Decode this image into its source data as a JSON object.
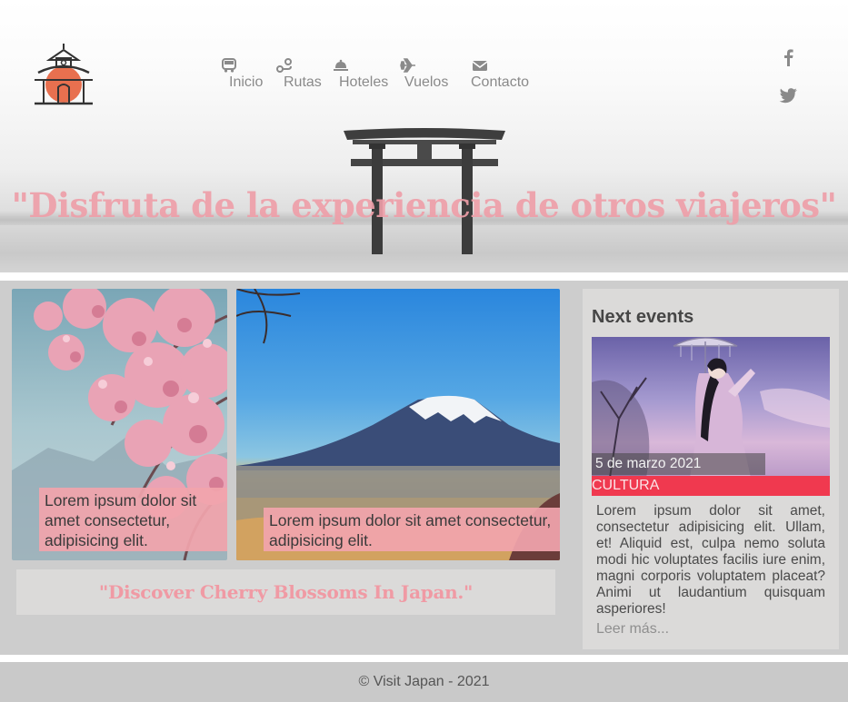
{
  "header": {
    "logo_icon": "pagoda-icon",
    "nav": [
      {
        "label": "Inicio",
        "icon": "bus-icon"
      },
      {
        "label": "Rutas",
        "icon": "route-icon"
      },
      {
        "label": "Hoteles",
        "icon": "bell-icon"
      },
      {
        "label": "Vuelos",
        "icon": "plane-icon"
      },
      {
        "label": "Contacto",
        "icon": "envelope-icon"
      }
    ],
    "social": [
      {
        "icon": "facebook-icon"
      },
      {
        "icon": "twitter-icon"
      }
    ],
    "hero_quote": "\"Disfruta de la experiencia de otros viajeros\""
  },
  "gallery": {
    "cherry_caption": "Lorem ipsum dolor sit amet consectetur, adipisicing elit.",
    "fuji_caption": "Lorem ipsum dolor sit amet consectetur, adipisicing elit.",
    "quote": "\"Discover Cherry Blossoms In Japan.\""
  },
  "events": {
    "title": "Next events",
    "date": "5 de marzo 2021",
    "tag": "CULTURA",
    "text": "Lorem ipsum dolor sit amet, consectetur adipisicing elit. Ullam, et! Aliquid est, culpa nemo soluta modi hic voluptates facilis iure enim, magni corporis voluptatem placeat? Animi ut laudantium quisquam asperiores!",
    "more": "Leer más..."
  },
  "footer": {
    "text": "© Visit Japan - 2021"
  },
  "colors": {
    "accent_pink": "#f1a4ac",
    "tag_red": "#f0394f",
    "nav_gray": "#8a8a8a",
    "band_gray": "#cdcdcd"
  }
}
